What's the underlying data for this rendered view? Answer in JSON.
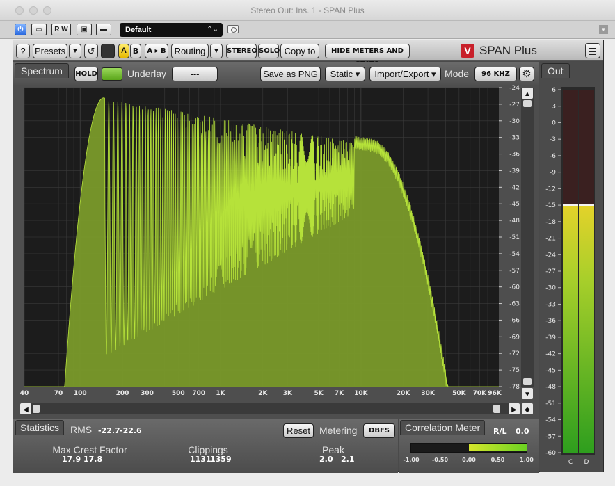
{
  "window": {
    "title": "Stereo Out: Ins. 1 - SPAN Plus"
  },
  "host": {
    "buttons": [
      "R",
      "W"
    ],
    "preset": "Default",
    "preset_arrows": "⌃⌄"
  },
  "toolbar": {
    "help": "?",
    "presets": "Presets",
    "a": "A",
    "b": "B",
    "a_to_b": "A ▸ B",
    "routing": "Routing",
    "stereo": "STEREO",
    "solo": "SOLO",
    "copy_to": "Copy to",
    "hide_meters": "HIDE METERS AND STATS",
    "logo_mark": "V",
    "brand": "SPAN Plus"
  },
  "spectrum": {
    "tab": "Spectrum",
    "hold": "HOLD",
    "underlay_label": "Underlay",
    "underlay_value": "---",
    "save_png": "Save as PNG",
    "static": "Static",
    "import_export": "Import/Export",
    "mode_label": "Mode",
    "mode_value": "96 KHZ",
    "freq_labels": [
      "40",
      "70",
      "100",
      "200",
      "300",
      "500",
      "700",
      "1K",
      "2K",
      "3K",
      "5K",
      "7K",
      "10K",
      "20K",
      "30K",
      "50K",
      "70K",
      "96K"
    ],
    "freq_values": [
      40,
      70,
      100,
      200,
      300,
      500,
      700,
      1000,
      2000,
      3000,
      5000,
      7000,
      10000,
      20000,
      30000,
      50000,
      70000,
      96000
    ],
    "db_labels": [
      "-24",
      "-27",
      "-30",
      "-33",
      "-36",
      "-39",
      "-42",
      "-45",
      "-48",
      "-51",
      "-54",
      "-57",
      "-60",
      "-63",
      "-66",
      "-69",
      "-72",
      "-75",
      "-78"
    ],
    "db_range": [
      -78,
      -24
    ],
    "freq_range": [
      40,
      96000
    ],
    "colors": {
      "fill": "#7a9a2a",
      "stroke": "#b6e23a",
      "background": "#1c1c1c",
      "grid": "#3a3a3a"
    }
  },
  "out_meter": {
    "tab": "Out",
    "scale": [
      "6",
      "3",
      "0",
      "-3",
      "-6",
      "-9",
      "-12",
      "-15",
      "-18",
      "-21",
      "-24",
      "-27",
      "-30",
      "-33",
      "-36",
      "-39",
      "-42",
      "-45",
      "-48",
      "-51",
      "-54",
      "-57",
      "-60"
    ],
    "scale_range": [
      -60,
      6
    ],
    "level_db": -15,
    "channels": [
      "C",
      "D"
    ]
  },
  "statistics": {
    "tab": "Statistics",
    "rms_label": "RMS",
    "rms_left": "-22.7",
    "rms_right": "-22.6",
    "reset": "Reset",
    "metering_label": "Metering",
    "metering_value": "DBFS",
    "max_crest_label": "Max Crest Factor",
    "max_crest_left": "17.9",
    "max_crest_right": "17.8",
    "clippings_label": "Clippings",
    "clippings_left": "1131",
    "clippings_right": "1359",
    "peak_label": "Peak",
    "peak_left": "2.0",
    "peak_right": "2.1"
  },
  "correlation": {
    "tab": "Correlation Meter",
    "mode": "R/L",
    "value": "0.0",
    "ticks": [
      "-1.00",
      "-0.50",
      "0.00",
      "0.50",
      "1.00"
    ],
    "fill_range": [
      0.0,
      1.0
    ]
  }
}
